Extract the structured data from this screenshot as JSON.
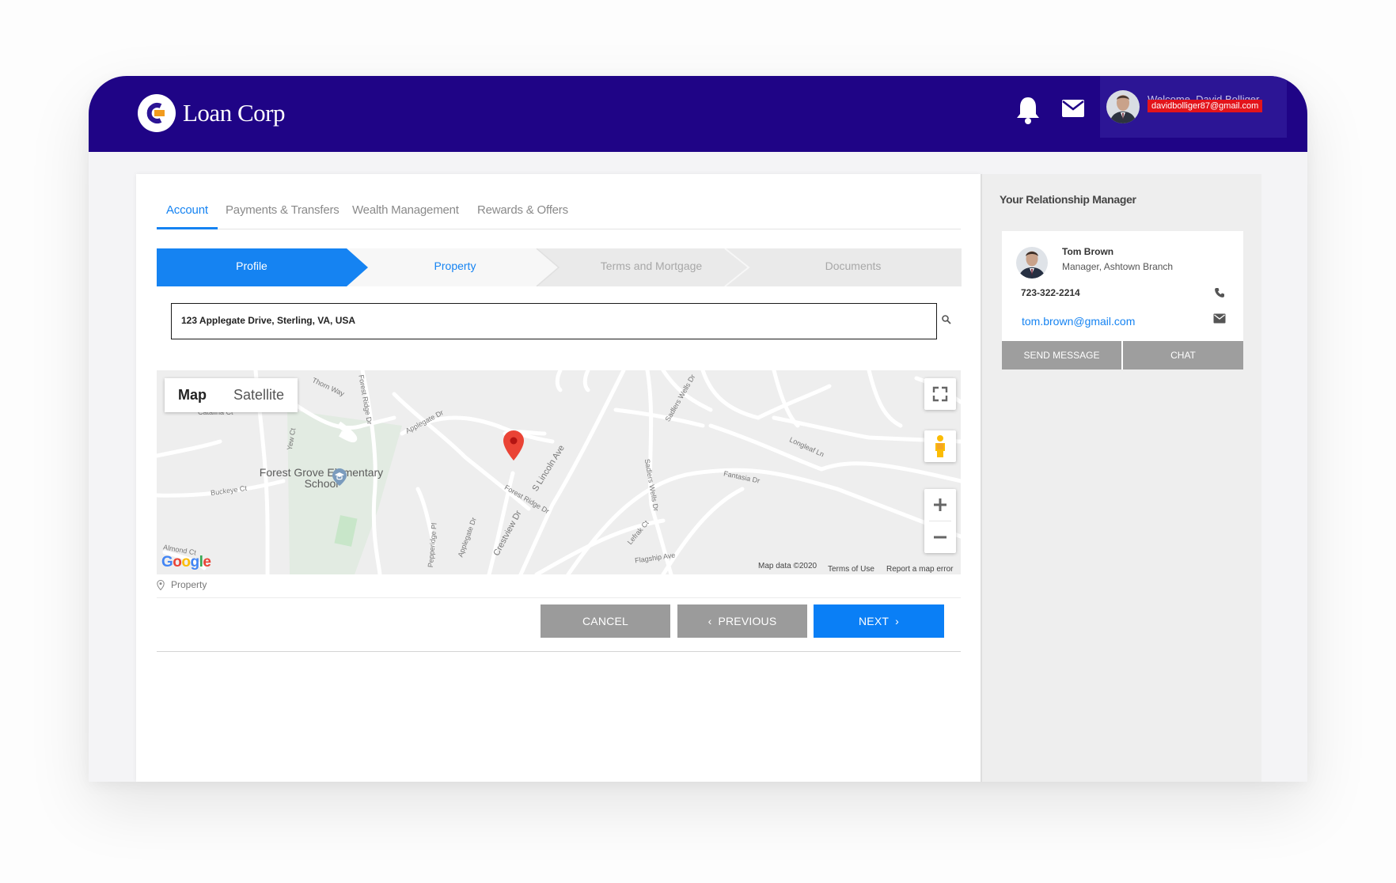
{
  "brand": {
    "name": "Loan Corp"
  },
  "header": {
    "greeting": "Welcome, David Bolliger",
    "email": "davidbolliger87@gmail.com"
  },
  "tabs": [
    {
      "label": "Account",
      "active": true
    },
    {
      "label": "Payments & Transfers",
      "active": false
    },
    {
      "label": "Wealth Management",
      "active": false
    },
    {
      "label": "Rewards & Offers",
      "active": false
    }
  ],
  "steps": [
    {
      "label": "Profile",
      "state": "done"
    },
    {
      "label": "Property",
      "state": "current"
    },
    {
      "label": "Terms and Mortgage",
      "state": "pending"
    },
    {
      "label": "Documents",
      "state": "pending"
    }
  ],
  "address": {
    "value": "123 Applegate Drive, Sterling, VA, USA"
  },
  "map": {
    "toggle": {
      "map": "Map",
      "satellite": "Satellite",
      "selected": "Map"
    },
    "school": "Forest Grove Elementary School",
    "streets": {
      "thorn": "Thorn Way",
      "forest_ridge_v": "Forest Ridge Dr",
      "applegate": "Applegate Dr",
      "yew": "Yew Ct",
      "buckeye": "Buckeye Ct",
      "almond": "Almond Ct",
      "forest_ridge": "Forest Ridge Dr",
      "lincoln": "S Lincoln Ave",
      "crestview": "Crestview Dr",
      "applegate_v": "Applegate Dr",
      "sadlers_top": "Sadlers Wells Dr",
      "sadlers_mid": "Sadlers Wells Dr",
      "fantasia": "Fantasia Dr",
      "longleaf": "Longleaf Ln",
      "flagship": "Flagship Ave",
      "lefrak": "Lefrak Ct",
      "pepperidge": "Pepperidge Pl",
      "catalina": "Catalina Ct"
    },
    "attribution": {
      "data": "Map data ©2020",
      "terms": "Terms of Use",
      "report": "Report a map error"
    },
    "google": {
      "g1": "G",
      "o1": "o",
      "o2": "o",
      "g2": "g",
      "l": "l",
      "e": "e"
    }
  },
  "legend": {
    "label": "Property"
  },
  "actions": {
    "cancel": "CANCEL",
    "previous": "PREVIOUS",
    "next": "NEXT"
  },
  "manager": {
    "section_title": "Your Relationship Manager",
    "name": "Tom Brown",
    "role": "Manager, Ashtown Branch",
    "phone": "723-322-2214",
    "email": "tom.brown@gmail.com",
    "send_message": "SEND MESSAGE",
    "chat": "CHAT"
  },
  "colors": {
    "header_bg": "#1f0486",
    "accent": "#1583f2",
    "button_gray": "#9b9b9b",
    "email_badge": "#e3141b",
    "pin": "#ea4335"
  },
  "icons": [
    "bell-icon",
    "mail-icon",
    "search-icon",
    "fullscreen-icon",
    "pegman-icon",
    "zoom-in-icon",
    "zoom-out-icon",
    "map-pin-icon",
    "location-icon",
    "phone-icon",
    "envelope-icon"
  ]
}
